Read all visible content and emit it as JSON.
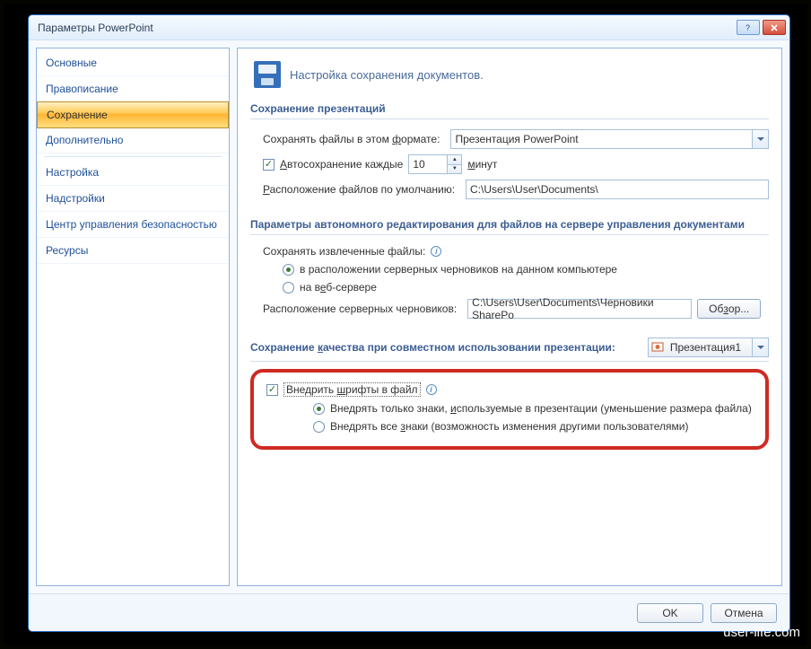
{
  "window": {
    "title": "Параметры PowerPoint"
  },
  "sidebar": {
    "items": [
      {
        "label": "Основные"
      },
      {
        "label": "Правописание"
      },
      {
        "label": "Сохранение"
      },
      {
        "label": "Дополнительно"
      },
      {
        "label": "Настройка"
      },
      {
        "label": "Надстройки"
      },
      {
        "label": "Центр управления безопасностью"
      },
      {
        "label": "Ресурсы"
      }
    ]
  },
  "header": {
    "text": "Настройка сохранения документов."
  },
  "sections": {
    "save_presentations": {
      "title": "Сохранение презентаций",
      "format_label_pre": "Сохранять файлы в этом ",
      "format_label_u": "ф",
      "format_label_post": "ормате:",
      "format_value": "Презентация PowerPoint",
      "autosave_label_u": "А",
      "autosave_label_post": "втосохранение каждые",
      "autosave_value": "10",
      "autosave_unit_u": "м",
      "autosave_unit_post": "инут",
      "default_loc_label_u": "Р",
      "default_loc_label_post": "асположение файлов по умолчанию:",
      "default_loc_value": "C:\\Users\\User\\Documents\\"
    },
    "offline": {
      "title": "Параметры автономного редактирования для файлов на сервере управления документами",
      "save_extracted_label": "Сохранять извлеченные файлы:",
      "radio_local": "в расположении серверных черновиков на данном компьютере",
      "radio_web_pre": "на в",
      "radio_web_u": "е",
      "radio_web_post": "б-сервере",
      "drafts_label": "Расположение серверных черновиков:",
      "drafts_value": "C:\\Users\\User\\Documents\\Черновики SharePo",
      "browse_label_pre": "Об",
      "browse_label_u": "з",
      "browse_label_post": "ор..."
    },
    "quality": {
      "title_pre": "Сохранение ",
      "title_u": "к",
      "title_post": "ачества при совместном использовании презентации:",
      "presentation_name": "Презентация1"
    },
    "embed": {
      "embed_label_pre": "Внедрить ",
      "embed_label_u": "ш",
      "embed_label_post": "рифты в файл",
      "radio_used_pre": "Внедрять только знаки, ",
      "radio_used_u": "и",
      "radio_used_post": "спользуемые в презентации (уменьшение размера файла)",
      "radio_all_pre": "Внедрять все ",
      "radio_all_u": "з",
      "radio_all_post": "наки (возможность изменения другими пользователями)"
    }
  },
  "footer": {
    "ok": "OK",
    "cancel": "Отмена"
  },
  "watermark": "user-life.com"
}
